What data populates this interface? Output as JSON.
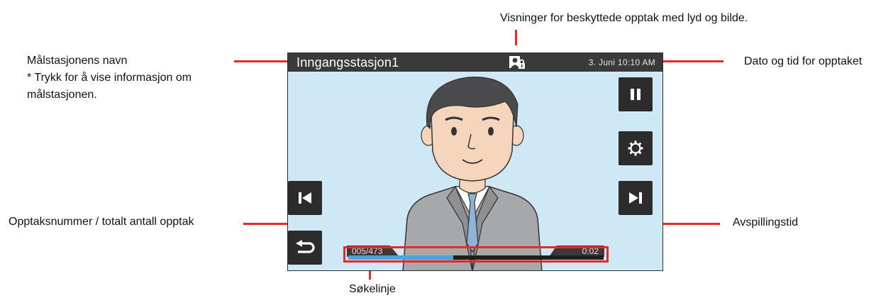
{
  "annotations": {
    "protected_view": "Visninger for beskyttede opptak med lyd og bilde.",
    "station_name_title": "Målstasjonens navn",
    "station_name_desc": "* Trykk for å vise informasjon om målstasjonen.",
    "datetime": "Dato og tid for opptaket",
    "recording_number": "Opptaksnummer / totalt antall opptak",
    "playback_time": "Avspillingstid",
    "seek_line": "Søkelinje"
  },
  "screen": {
    "station_name": "Inngangsstasjon1",
    "date_time": "3. Juni 10:10 AM",
    "recording_counter": "005/473",
    "playback_time": "0:02",
    "seek_progress": 0.41,
    "icons": {
      "protected": "protected-recording-icon",
      "pause": "pause-icon",
      "settings": "gear-icon",
      "previous": "skip-previous-icon",
      "next": "skip-next-icon",
      "back": "back-arrow-icon"
    }
  },
  "colors": {
    "annotation_red": "#e8282b",
    "screen_background": "#cfe8f6",
    "bar_dark": "#3a3a3a",
    "seek_fill": "#4aa6d8"
  }
}
